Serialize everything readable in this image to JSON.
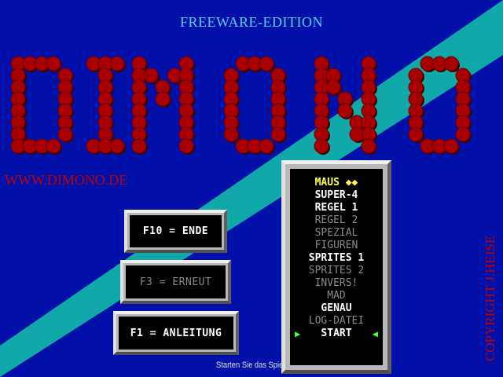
{
  "header": {
    "edition": "FREEWARE-EDITION"
  },
  "logo": {
    "text": "DIMONO"
  },
  "website": "WWW.DIMONO.DE",
  "copyright": "COPYRIGHT J.HEISE",
  "buttons": {
    "quit": "F10 = ENDE",
    "restart": "F3 = ERNEUT",
    "manual": "F1 = ANLEITUNG"
  },
  "menu": {
    "items": [
      {
        "label": "MAUS ◆◆",
        "state": "selected"
      },
      {
        "label": "SUPER-4",
        "state": "enabled"
      },
      {
        "label": "REGEL 1",
        "state": "enabled"
      },
      {
        "label": "REGEL 2",
        "state": "disabled"
      },
      {
        "label": "SPEZIAL",
        "state": "disabled"
      },
      {
        "label": "FIGUREN",
        "state": "disabled"
      },
      {
        "label": "SPRITES 1",
        "state": "enabled"
      },
      {
        "label": "SPRITES 2",
        "state": "disabled"
      },
      {
        "label": "INVERS!",
        "state": "disabled"
      },
      {
        "label": "MAD",
        "state": "disabled"
      },
      {
        "label": "GENAU",
        "state": "enabled"
      },
      {
        "label": "LOG-DATEI",
        "state": "disabled"
      },
      {
        "label": "START",
        "state": "start"
      }
    ]
  },
  "status": "Starten Sie das Spiel.",
  "colors": {
    "background": "#0010a8",
    "stripe": "#10a8a8",
    "logo_red": "#a80000",
    "url_red": "#c00000"
  }
}
